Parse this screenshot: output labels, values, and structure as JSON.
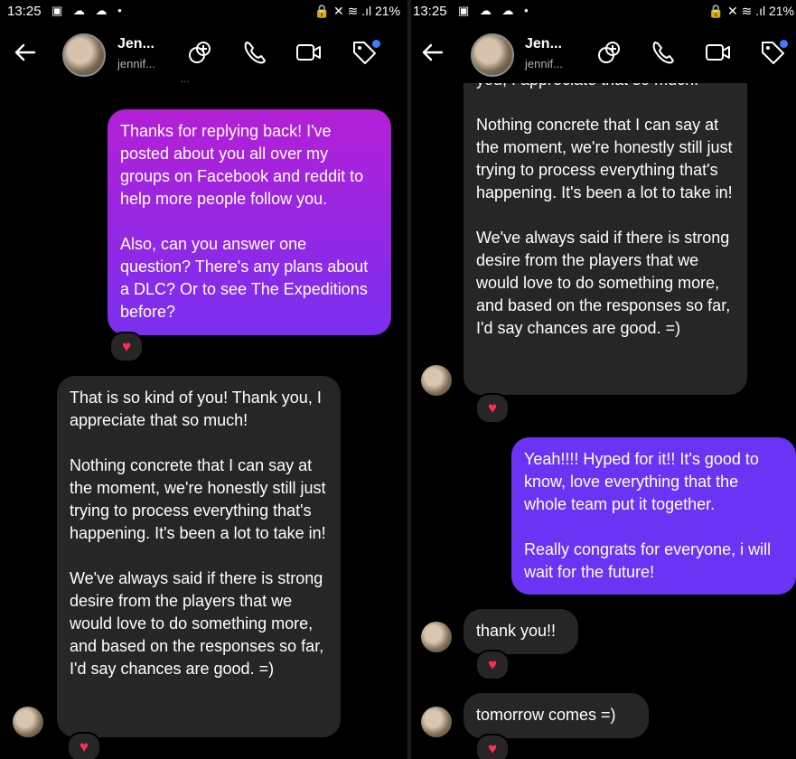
{
  "status": {
    "time": "13:25",
    "battery": "21%",
    "left_icons": "▣ ☁ ☁ •",
    "right_icons": "🔒 ✕ ≋ .ıl"
  },
  "contact": {
    "name": "Jen...",
    "handle": "jennif..."
  },
  "heart": "♥",
  "left": {
    "top_cut": "...",
    "msg_out": "Thanks for replying back! I've posted about you all over my groups on Facebook and reddit to help more people follow you.\n\nAlso, can you answer one question? There's any plans about a DLC? Or to see The Expeditions before?",
    "msg_in": "That is so kind of you! Thank you, I appreciate that so much!\n\nNothing concrete that I can say at the moment, we're honestly still just trying to process everything that's happening. It's been a lot to take in!\n\nWe've always said if there is strong desire from the players that we would love to do something more, and based on the responses so far, I'd say chances are good. =)"
  },
  "right": {
    "top_cut": "you, I appreciate that so much!",
    "msg_in": "Nothing concrete that I can say at the moment, we're honestly still just trying to process everything that's happening. It's been a lot to take in!\n\nWe've always said if there is strong desire from the players that we would love to do something more, and based on the responses so far, I'd say chances are good. =)",
    "msg_out": "Yeah!!!! Hyped for it!! It's good to know, love everything that the whole team put it together.\n\nReally congrats for everyone, i will wait for the future!",
    "msg_thanks": "thank you!!",
    "msg_tomorrow": "tomorrow comes =)"
  }
}
